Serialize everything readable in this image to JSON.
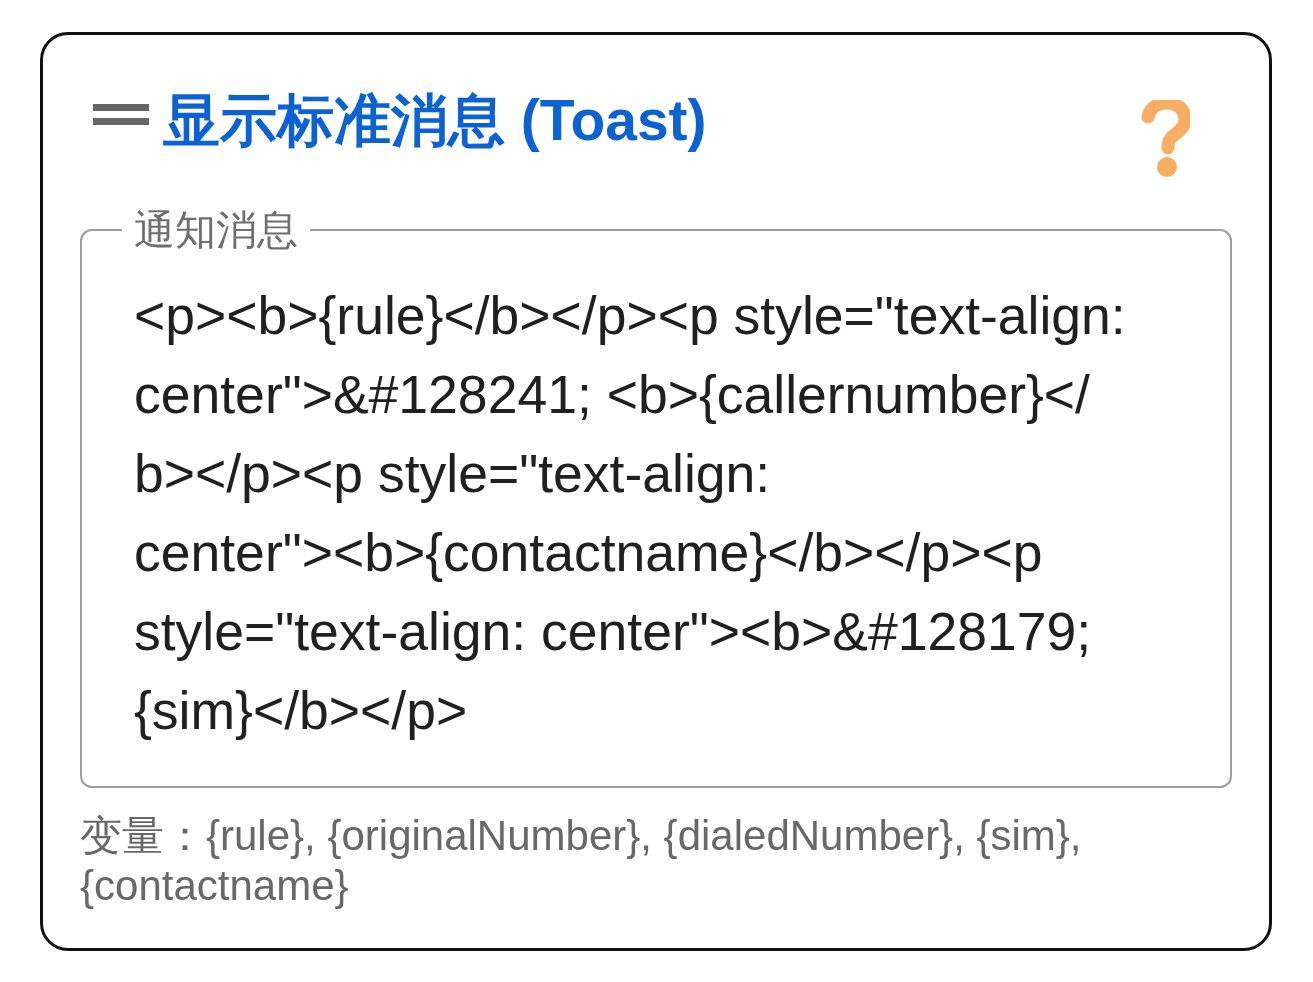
{
  "card": {
    "title": "显示标准消息 (Toast)",
    "message_field": {
      "label": "通知消息",
      "value": "<p><b>{rule}</b></p><p style=\"text-align: center\">&#128241; <b>{callernumber}</b></p><p style=\"text-align: center\"><b>{contactname}</b></p><p style=\"text-align: center\"><b>&#128179; {sim}</b></p>"
    },
    "hint": "变量：{rule}, {originalNumber}, {dialedNumber}, {sim}, {contactname}"
  }
}
